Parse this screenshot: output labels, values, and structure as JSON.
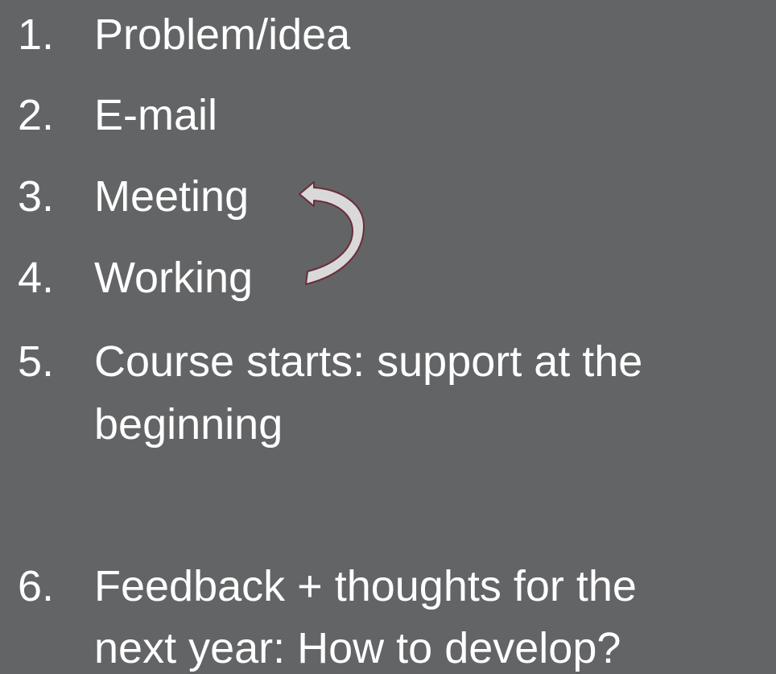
{
  "colors": {
    "background": "#636466",
    "text": "#ffffff",
    "arrow_fill": "#d9d9d9",
    "arrow_stroke": "#6b2d3a"
  },
  "steps": [
    {
      "number": "1.",
      "lines": [
        "Problem/idea"
      ]
    },
    {
      "number": "2.",
      "lines": [
        "E-mail"
      ]
    },
    {
      "number": "3.",
      "lines": [
        "Meeting"
      ]
    },
    {
      "number": "4.",
      "lines": [
        "Working"
      ]
    },
    {
      "number": "5.",
      "lines": [
        "Course starts: support at the",
        "beginning"
      ]
    },
    {
      "number": "6.",
      "lines": [
        "Feedback + thoughts for the",
        "next year: How to develop?"
      ]
    }
  ],
  "loop_arrow": {
    "icon": "curved-loop-arrow-icon",
    "from_step": "4.",
    "to_step": "3."
  }
}
